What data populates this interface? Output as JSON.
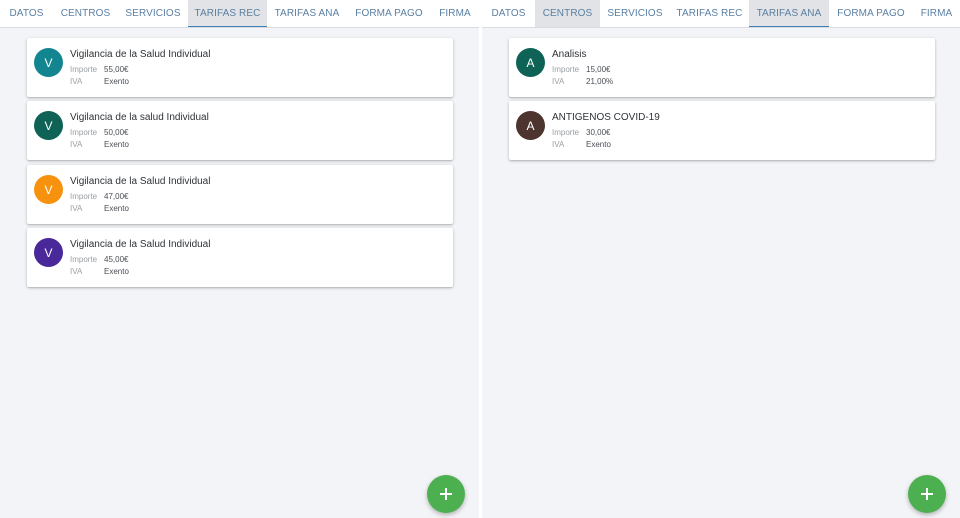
{
  "left": {
    "tabs": [
      {
        "label": "DATOS"
      },
      {
        "label": "CENTROS"
      },
      {
        "label": "SERVICIOS"
      },
      {
        "label": "TARIFAS REC"
      },
      {
        "label": "TARIFAS ANA"
      },
      {
        "label": "FORMA PAGO"
      },
      {
        "label": "FIRMA"
      }
    ],
    "active_tab": "TARIFAS REC",
    "labels": {
      "importe": "Importe",
      "iva": "IVA"
    },
    "items": [
      {
        "initial": "V",
        "color": "#138591",
        "title": "Vigilancia de la Salud Individual",
        "importe": "55,00€",
        "iva": "Exento"
      },
      {
        "initial": "V",
        "color": "#0e6356",
        "title": "Vigilancia de la salud Individual",
        "importe": "50,00€",
        "iva": "Exento"
      },
      {
        "initial": "V",
        "color": "#f7920f",
        "title": "Vigilancia de la Salud Individual",
        "importe": "47,00€",
        "iva": "Exento"
      },
      {
        "initial": "V",
        "color": "#49289a",
        "title": "Vigilancia de la Salud Individual",
        "importe": "45,00€",
        "iva": "Exento"
      }
    ],
    "fab": {
      "icon": "plus-icon",
      "color": "#4caf50"
    }
  },
  "right": {
    "tabs": [
      {
        "label": "DATOS"
      },
      {
        "label": "CENTROS"
      },
      {
        "label": "SERVICIOS"
      },
      {
        "label": "TARIFAS REC"
      },
      {
        "label": "TARIFAS ANA"
      },
      {
        "label": "FORMA PAGO"
      },
      {
        "label": "FIRMA"
      }
    ],
    "active_tab": "TARIFAS ANA",
    "hovered_tab": "CENTROS",
    "labels": {
      "importe": "Importe",
      "iva": "IVA"
    },
    "items": [
      {
        "initial": "A",
        "color": "#0e6356",
        "title": "Analisis",
        "importe": "15,00€",
        "iva": "21,00%"
      },
      {
        "initial": "A",
        "color": "#4e342e",
        "title": "ANTIGENOS COVID-19",
        "importe": "30,00€",
        "iva": "Exento"
      }
    ],
    "fab": {
      "icon": "plus-icon",
      "color": "#4caf50"
    }
  }
}
